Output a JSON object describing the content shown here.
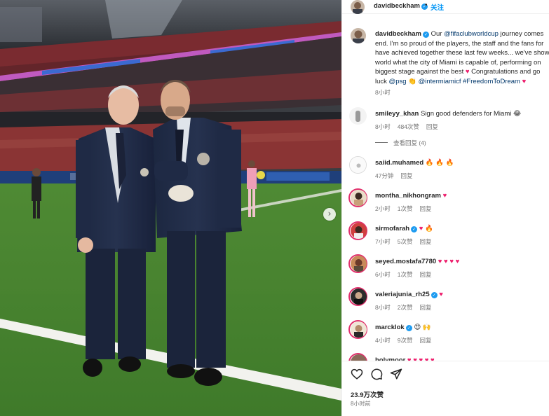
{
  "post": {
    "author": "davidbeckham",
    "follow_label": "关注",
    "caption_lines": [
      {
        "prefix_bold": "davidbeckham",
        "text": " Our ",
        "link": "@fifaclubworldcup",
        "rest": " journey comes"
      },
      {
        "text": "end. I'm so proud of the players, the staff and the fans for"
      },
      {
        "text": "have achieved together these last few weeks... we've show"
      },
      {
        "text": "world what the city of Miami is capable of, performing on"
      },
      {
        "text": "biggest stage against the best ",
        "heart": "♥",
        "rest": " Congratulations and go"
      },
      {
        "text": "luck ",
        "link": "@psg",
        "mid": " 👏 ",
        "link2": "@intermiamicf #FreedomToDream",
        "heart": " ♥"
      }
    ],
    "caption_time": "8小时",
    "likes": "23.9万次赞",
    "posted_time": "8小时前"
  },
  "comments": [
    {
      "user": "smileyy_khan",
      "text": "Sign good defenders for Miami",
      "emoji": "😂",
      "time": "8小时",
      "likes": "484次赞",
      "reply": "回复",
      "replies_label": "查看回复 (4)"
    },
    {
      "user": "saiid.muhamed",
      "text": "",
      "emoji": "🔥 🔥 🔥",
      "time": "47分钟",
      "likes": "",
      "reply": "回复"
    },
    {
      "user": "montha_nikhongram",
      "text": "",
      "emoji": "♥",
      "time": "2小时",
      "likes": "1次赞",
      "reply": "回复"
    },
    {
      "user": "sirmofarah",
      "text": "",
      "emoji": "♥ 🔥",
      "verified": true,
      "time": "7小时",
      "likes": "5次赞",
      "reply": "回复"
    },
    {
      "user": "seyed.mostafa7780",
      "text": "",
      "emoji": "♥ ♥ ♥ ♥",
      "time": "6小时",
      "likes": "1次赞",
      "reply": "回复"
    },
    {
      "user": "valeriajunia_rh25",
      "text": "",
      "emoji": "♥",
      "verified": true,
      "time": "8小时",
      "likes": "2次赞",
      "reply": "回复"
    },
    {
      "user": "marcklok",
      "text": "",
      "emoji": "😍 🙌",
      "verified": true,
      "time": "4小时",
      "likes": "9次赞",
      "reply": "回复"
    },
    {
      "user": "holymoor",
      "text": "",
      "emoji": "♥ ♥ ♥ ♥ ♥",
      "time": "",
      "likes": "",
      "reply": ""
    }
  ],
  "icons": {
    "like": "heart-icon",
    "comment": "comment-icon",
    "share": "send-icon",
    "next": "chevron-right-icon",
    "verified": "verified-badge-icon"
  },
  "colors": {
    "link": "#00376b",
    "follow": "#0095f6",
    "heart": "#ed1c6b",
    "verified": "#1d9bf0"
  }
}
